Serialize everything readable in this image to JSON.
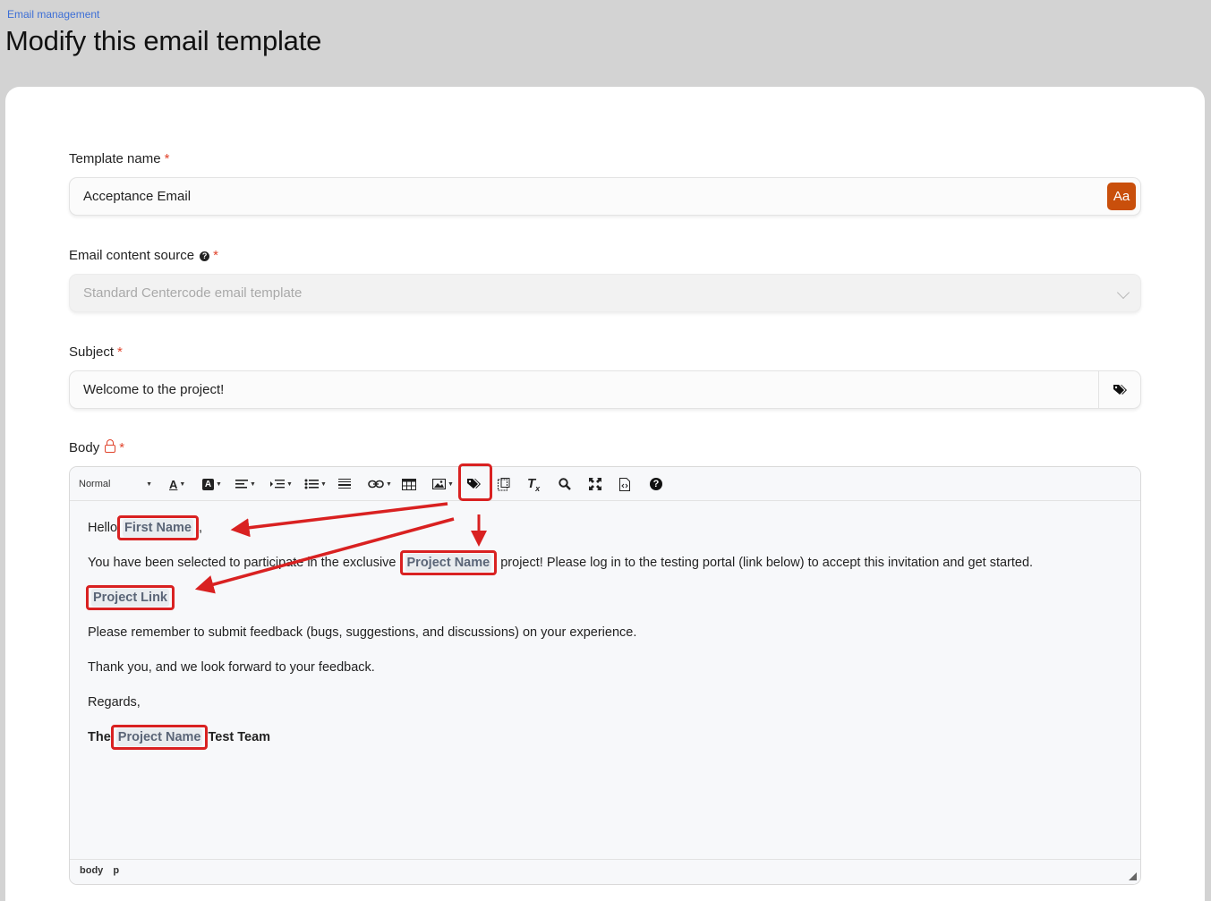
{
  "breadcrumb": "Email management",
  "page_title": "Modify this email template",
  "fields": {
    "template_name": {
      "label": "Template name",
      "value": "Acceptance Email",
      "button": "Aa"
    },
    "content_source": {
      "label": "Email content source",
      "help": "?",
      "value": "Standard Centercode email template"
    },
    "subject": {
      "label": "Subject",
      "value": "Welcome to the project!"
    },
    "body": {
      "label": "Body"
    }
  },
  "required_mark": "*",
  "toolbar": {
    "format_select": "Normal",
    "items": [
      "font-color-icon",
      "background-color-icon",
      "align-icon",
      "indent-icon",
      "list-icon",
      "horizontal-rule-icon",
      "link-icon",
      "table-icon",
      "image-icon",
      "tag-icon",
      "template-icon",
      "clear-format-icon",
      "search-icon",
      "fullscreen-icon",
      "source-icon",
      "help-icon"
    ]
  },
  "email": {
    "greeting_pre": "Hello",
    "first_name": "First Name",
    "greeting_post": ",",
    "line2_pre": "You have been selected to participate in the exclusive",
    "project_name": "Project Name",
    "line2_post": "project! Please log in to the testing portal (link below) to accept this invitation and get started.",
    "project_link": "Project Link",
    "line4": "Please remember to submit feedback (bugs, suggestions, and discussions) on your experience.",
    "line5": "Thank you, and we look forward to your feedback.",
    "line6": "Regards,",
    "sign_pre": "The",
    "sign_name": "Project Name",
    "sign_post": "Test Team"
  },
  "statusbar": [
    "body",
    "p"
  ],
  "colors": {
    "accent": "#c94f0b",
    "link": "#3d6fd6",
    "annotation": "#d92121",
    "required": "#e0432b"
  }
}
